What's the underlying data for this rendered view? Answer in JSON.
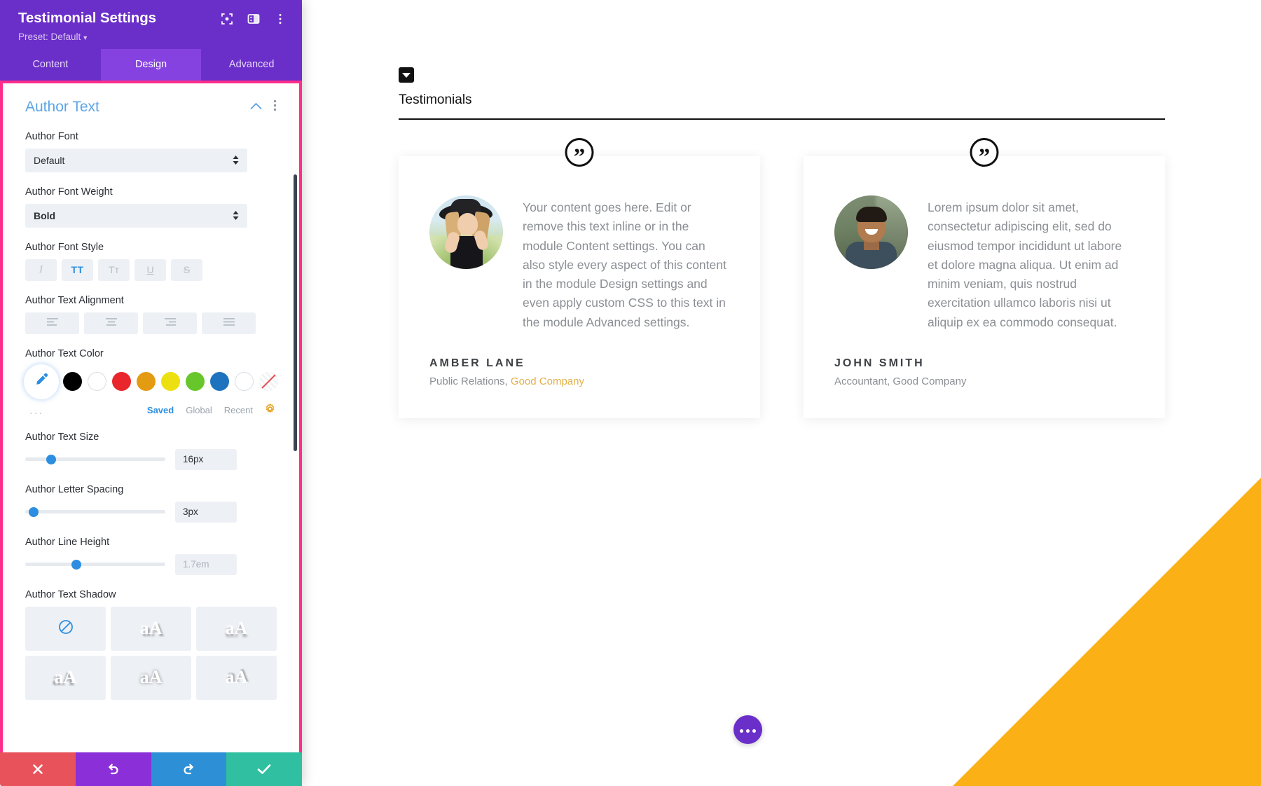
{
  "panel": {
    "title": "Testimonial Settings",
    "preset_label": "Preset: Default",
    "header_icons": [
      "target-icon",
      "layout-icon",
      "kebab-menu-icon"
    ],
    "tabs": [
      {
        "label": "Content",
        "active": false
      },
      {
        "label": "Design",
        "active": true
      },
      {
        "label": "Advanced",
        "active": false
      }
    ],
    "section": {
      "title": "Author Text",
      "collapse_icon": "chevron-up-icon",
      "menu_icon": "kebab-menu-icon"
    },
    "fields": {
      "author_font": {
        "label": "Author Font",
        "value": "Default"
      },
      "author_font_weight": {
        "label": "Author Font Weight",
        "value": "Bold"
      },
      "author_font_style": {
        "label": "Author Font Style",
        "options": [
          {
            "name": "italic",
            "glyph": "I",
            "active": false
          },
          {
            "name": "uppercase",
            "glyph": "TT",
            "active": true
          },
          {
            "name": "smallcaps",
            "glyph": "Tᴛ",
            "active": false
          },
          {
            "name": "underline",
            "glyph": "U",
            "active": false
          },
          {
            "name": "strikethrough",
            "glyph": "S",
            "active": false
          }
        ]
      },
      "author_text_alignment": {
        "label": "Author Text Alignment",
        "options": [
          "align-left",
          "align-center",
          "align-right",
          "align-justify"
        ],
        "active_index": -1
      },
      "author_text_color": {
        "label": "Author Text Color",
        "eyedropper": "eyedropper-icon",
        "swatches": [
          "#000000",
          "#FFFFFF",
          "#E8262B",
          "#E39B12",
          "#EDE010",
          "#67C72A",
          "#1E73BE",
          "#FFFFFF",
          "none"
        ],
        "more": "...",
        "tabs": [
          {
            "label": "Saved",
            "active": true
          },
          {
            "label": "Global",
            "active": false
          },
          {
            "label": "Recent",
            "active": false
          }
        ],
        "settings_icon": "gear-icon"
      },
      "author_text_size": {
        "label": "Author Text Size",
        "value": "16px",
        "knob_pct": 17
      },
      "author_letter_spacing": {
        "label": "Author Letter Spacing",
        "value": "3px",
        "knob_pct": 4
      },
      "author_line_height": {
        "label": "Author Line Height",
        "value": "1.7em",
        "placeholder": true,
        "knob_pct": 36
      },
      "author_text_shadow": {
        "label": "Author Text Shadow",
        "presets": [
          {
            "name": "none",
            "glyph": "⊘",
            "active": true
          },
          {
            "name": "shadow-bottom-right",
            "glyph": "aA",
            "active": false
          },
          {
            "name": "shadow-bottom",
            "glyph": "aA",
            "active": false
          },
          {
            "name": "shadow-bottom-left",
            "glyph": "aA",
            "active": false
          },
          {
            "name": "shadow-blur",
            "glyph": "aA",
            "active": false
          },
          {
            "name": "shadow-top-right",
            "glyph": "aA",
            "active": false
          }
        ]
      }
    },
    "footer": [
      {
        "name": "discard-button",
        "icon": "close-icon",
        "color": "#E8525B"
      },
      {
        "name": "undo-button",
        "icon": "undo-icon",
        "color": "#8B2FD8"
      },
      {
        "name": "redo-button",
        "icon": "redo-icon",
        "color": "#2D8FD5"
      },
      {
        "name": "save-button",
        "icon": "check-icon",
        "color": "#30BFA0"
      }
    ]
  },
  "page": {
    "section_title": "Testimonials",
    "section_badge_icon": "triangle-down-icon",
    "testimonials": [
      {
        "avatar": "amber-lane-photo",
        "quote_icon": "quote-mark-icon",
        "quote": "Your content goes here. Edit or remove this text inline or in the module Content settings. You can also style every aspect of this content in the module Design settings and even apply custom CSS to this text in the module Advanced settings.",
        "name": "AMBER LANE",
        "position_prefix": "Public Relations, ",
        "company": "Good Company",
        "company_highlight": true
      },
      {
        "avatar": "john-smith-photo",
        "quote_icon": "quote-mark-icon",
        "quote": "Lorem ipsum dolor sit amet, consectetur adipiscing elit, sed do eiusmod tempor incididunt ut labore et dolore magna aliqua. Ut enim ad minim veniam, quis nostrud exercitation ullamco laboris nisi ut aliquip ex ea commodo consequat.",
        "name": "JOHN SMITH",
        "position_prefix": "Accountant, Good Company",
        "company": "",
        "company_highlight": false
      }
    ],
    "fab": {
      "name": "page-settings-fab",
      "icon": "ellipsis-icon"
    }
  },
  "colors": {
    "panel_purple": "#6B2FC9",
    "tab_active_purple": "#8642E0",
    "highlight_pink": "#FF2D8A",
    "accent_blue": "#2C8EE0",
    "section_blue": "#5BA4E6",
    "gold": "#E3B04B",
    "wedge_orange": "#FBB016"
  }
}
